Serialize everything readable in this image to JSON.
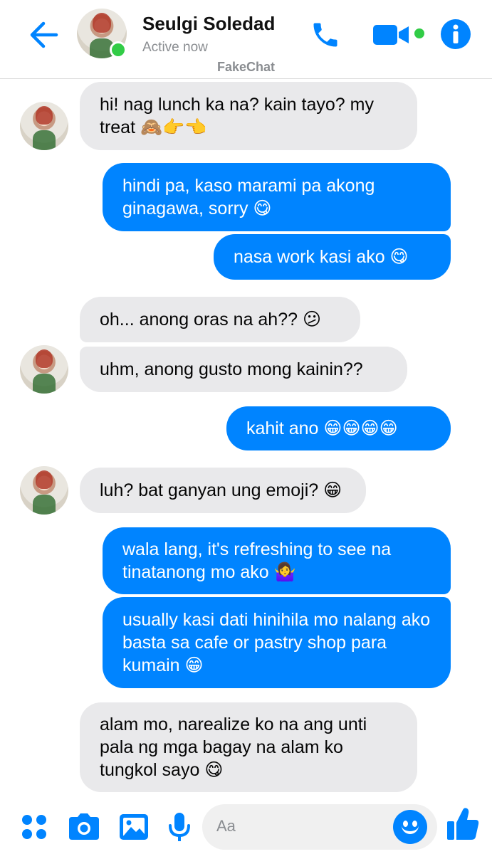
{
  "colors": {
    "accent": "#0084ff",
    "incoming_bubble": "#e9e9eb",
    "online": "#31cc46",
    "muted": "#8a8d91"
  },
  "header": {
    "contact_name": "Seulgi Soledad",
    "status": "Active now",
    "brand": "FakeChat",
    "icons": [
      "back-arrow-icon",
      "phone-icon",
      "video-camera-icon",
      "info-icon"
    ]
  },
  "messages": [
    {
      "sender": "contact",
      "text": "hi! nag lunch ka na? kain tayo? my treat 🙈👉👈"
    },
    {
      "sender": "me",
      "text": "hindi pa, kaso marami pa akong ginagawa, sorry 😋"
    },
    {
      "sender": "me",
      "text": "nasa work kasi ako 😋"
    },
    {
      "sender": "contact",
      "text": "oh... anong oras na ah?? 😕"
    },
    {
      "sender": "contact",
      "text": "uhm, anong gusto mong kainin??"
    },
    {
      "sender": "me",
      "text": "kahit ano 😁😁😁😁"
    },
    {
      "sender": "contact",
      "text": "luh? bat ganyan ung emoji? 😁"
    },
    {
      "sender": "me",
      "text": "wala lang, it's refreshing to see na tinatanong mo ako 🤷‍♀️"
    },
    {
      "sender": "me",
      "text": "usually kasi dati hinihila mo nalang ako basta sa cafe or pastry shop para kumain 😁"
    },
    {
      "sender": "contact",
      "text": "alam mo, narealize ko na ang unti pala ng mga bagay na alam ko tungkol sayo 😋"
    }
  ],
  "composer": {
    "placeholder": "Aa",
    "icons": [
      "menu-grid-icon",
      "camera-icon",
      "gallery-icon",
      "microphone-icon",
      "emoji-icon",
      "thumbs-up-icon"
    ]
  }
}
